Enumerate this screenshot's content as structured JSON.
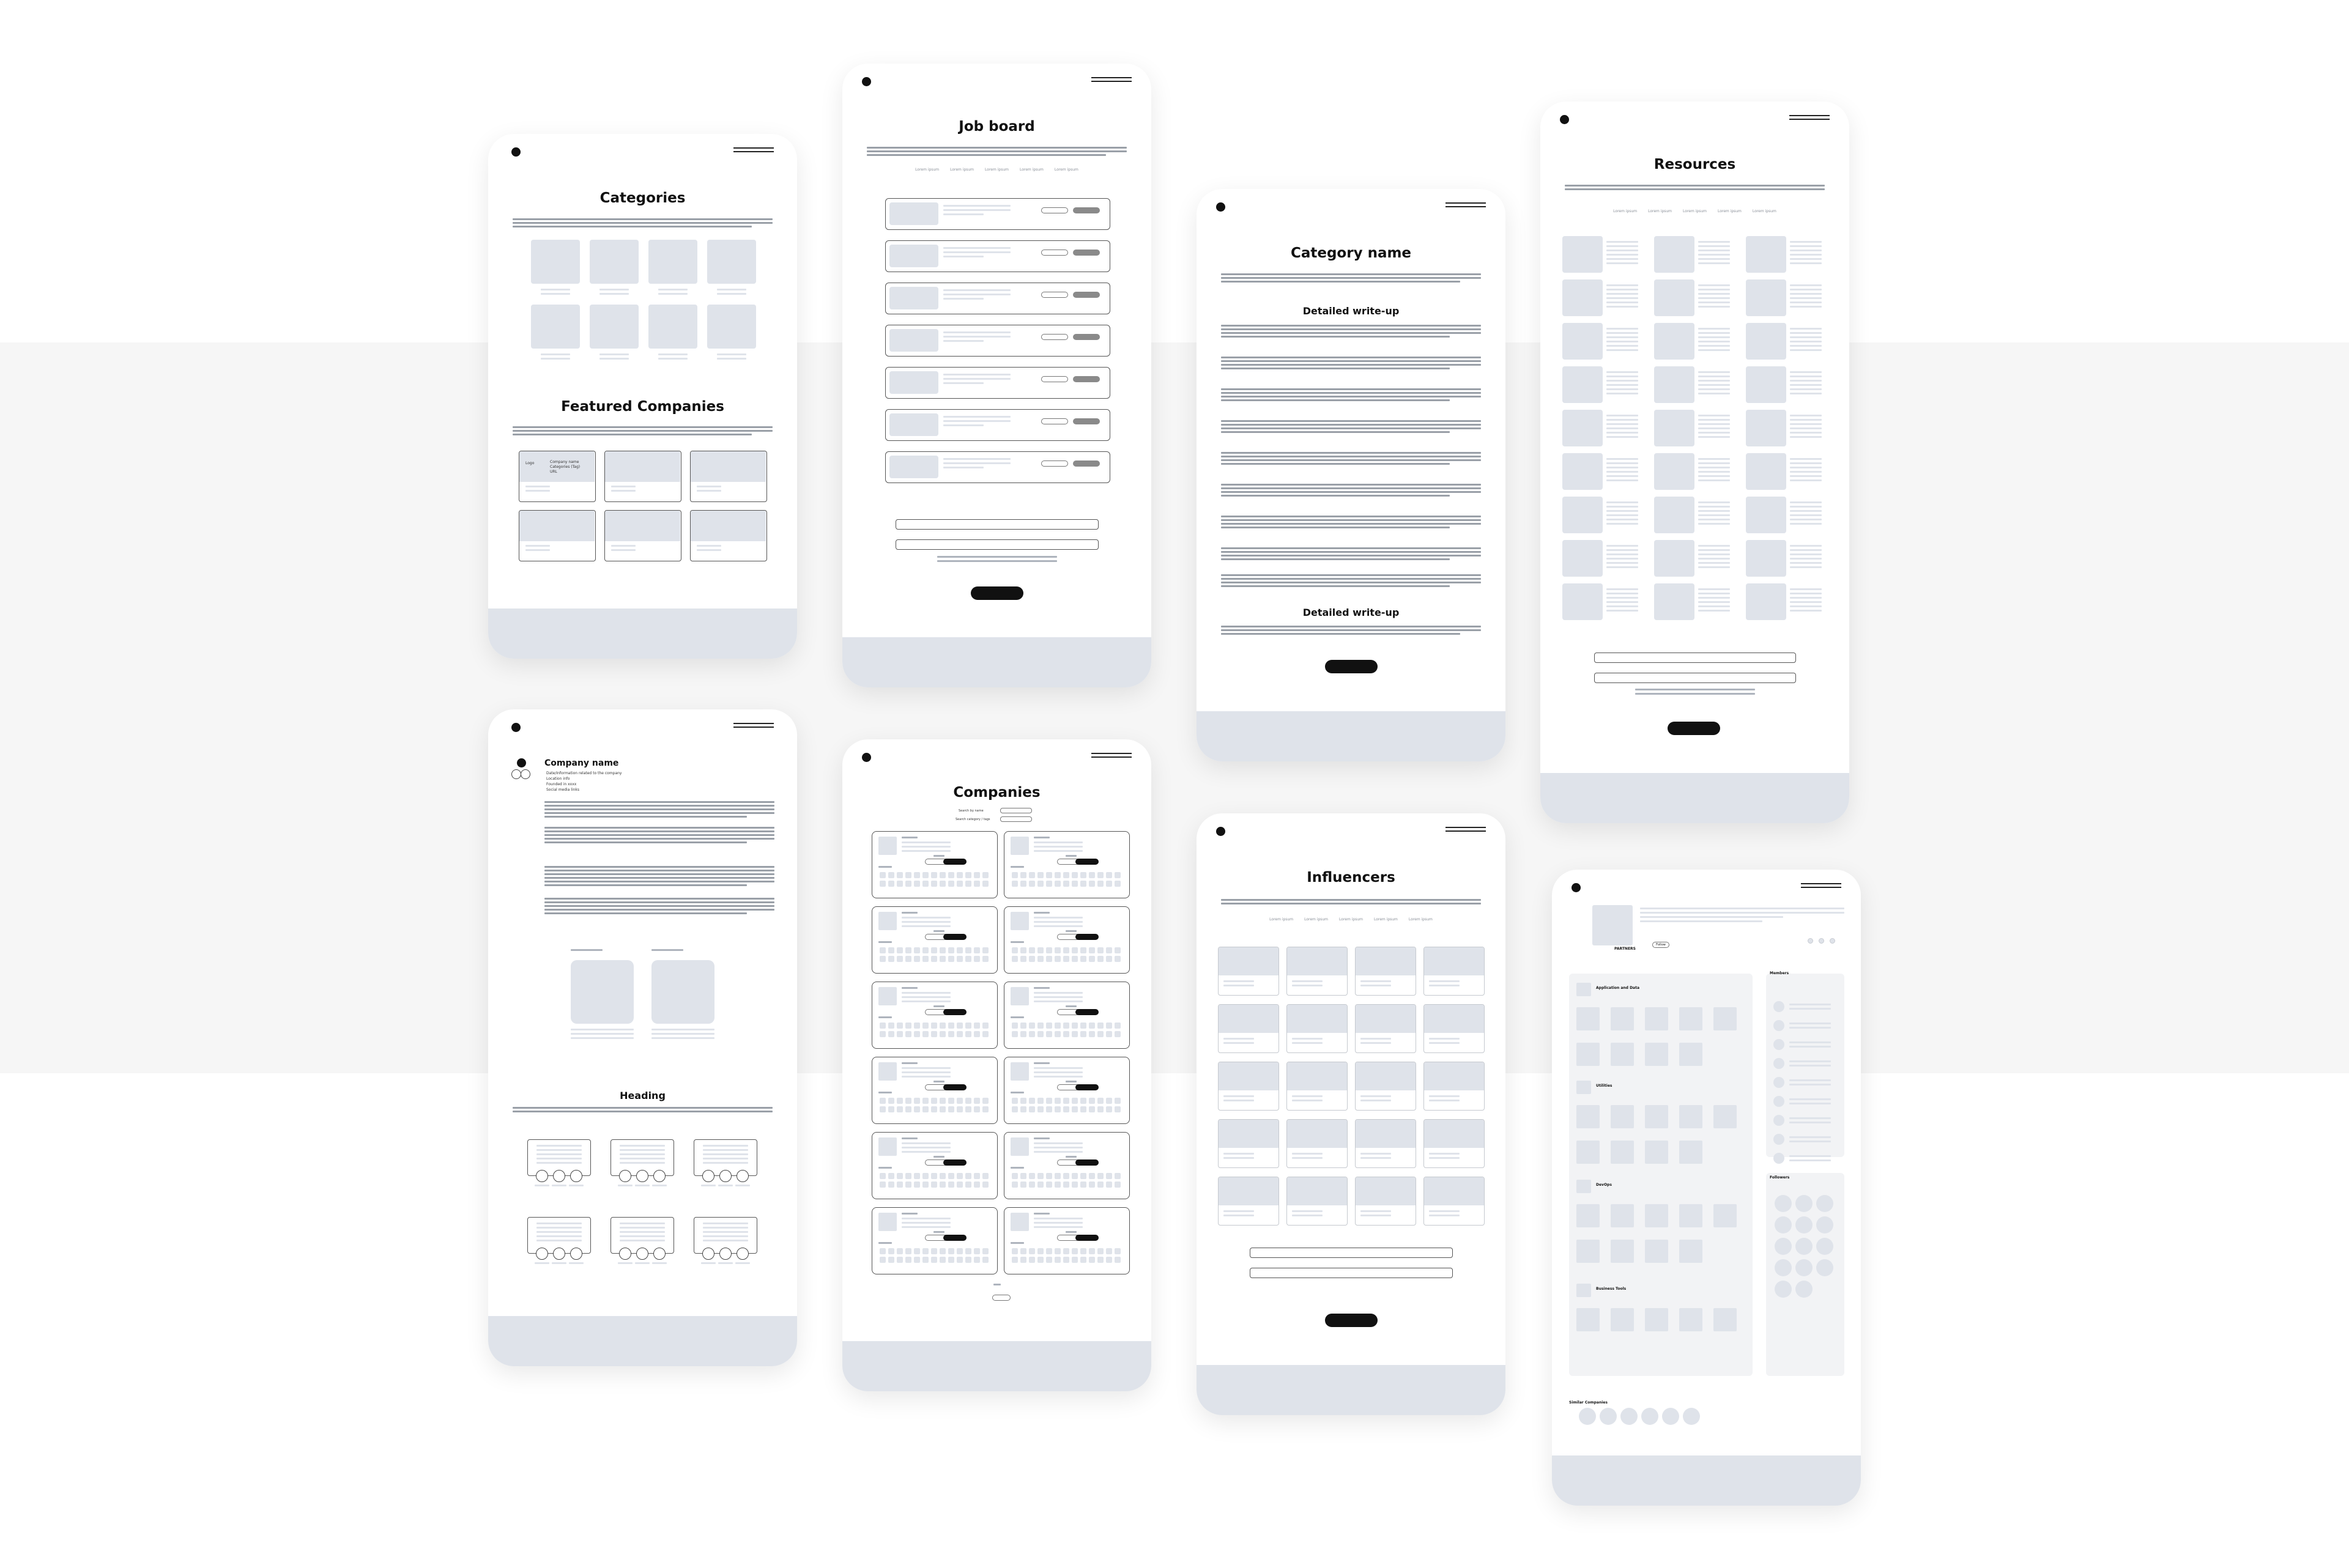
{
  "categories": {
    "title": "Categories",
    "featured_title": "Featured Companies",
    "featured_logo": "Logo",
    "featured_company": "Company name",
    "featured_category": "Categories (Tag)",
    "featured_sub": "URL"
  },
  "job_board": {
    "title": "Job board",
    "tabs": [
      "Lorem ipsum",
      "Lorem ipsum",
      "Lorem ipsum",
      "Lorem ipsum",
      "Lorem ipsum"
    ]
  },
  "category_page": {
    "title": "Category name",
    "writeup_1": "Detailed write-up",
    "writeup_2": "Detailed write-up"
  },
  "resources": {
    "title": "Resources",
    "tabs": [
      "Lorem ipsum",
      "Lorem ipsum",
      "Lorem ipsum",
      "Lorem ipsum",
      "Lorem ipsum"
    ]
  },
  "company_page": {
    "title": "Company name",
    "details": [
      "Date/Information related to the company",
      "Location info",
      "Founded in xxxx",
      "Social media links"
    ],
    "heading": "Heading"
  },
  "companies": {
    "title": "Companies",
    "filter_1": "Search by name",
    "filter_2": "Search category / tags"
  },
  "influencers": {
    "title": "Influencers",
    "tabs": [
      "Lorem ipsum",
      "Lorem ipsum",
      "Lorem ipsum",
      "Lorem ipsum",
      "Lorem ipsum"
    ]
  },
  "profile": {
    "name_tag": "PARTNERS",
    "follow": "Follow",
    "sections": [
      "Application and Data",
      "Utilities",
      "DevOps",
      "Business Tools"
    ],
    "members": "Members",
    "followers": "Followers",
    "similar": "Similar Companies"
  }
}
